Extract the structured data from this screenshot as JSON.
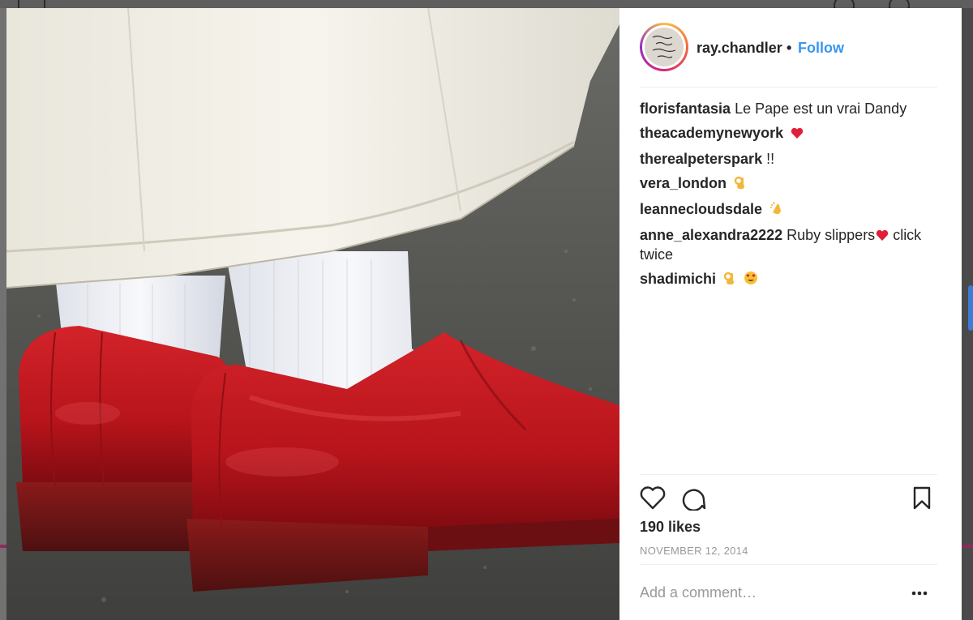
{
  "post": {
    "username": "ray.chandler",
    "separator": "•",
    "follow_label": "Follow",
    "avatar_icon": "handwritten-note-avatar",
    "likes": "190 likes",
    "date": "NOVEMBER 12, 2014",
    "comment_placeholder": "Add a comment…",
    "more_label": "•••"
  },
  "comments": [
    {
      "author": "florisfantasia",
      "text": "Le Pape est un vrai Dandy",
      "emojis": []
    },
    {
      "author": "theacademynewyork",
      "text": "",
      "emojis": [
        "heart"
      ]
    },
    {
      "author": "therealpeterspark",
      "text": "!!",
      "emojis": []
    },
    {
      "author": "vera_london",
      "text": "",
      "emojis": [
        "ok-hand"
      ]
    },
    {
      "author": "leannecloudsdale",
      "text": "",
      "emojis": [
        "clapping-hands"
      ]
    },
    {
      "author": "anne_alexandra2222",
      "text": "Ruby slippers",
      "emojis": [
        "heart"
      ],
      "text_after": " click twice"
    },
    {
      "author": "shadimichi",
      "text": "",
      "emojis": [
        "ok-hand",
        "heart-eyes"
      ]
    }
  ],
  "icons": {
    "like": "heart-outline-icon",
    "comment": "speech-bubble-icon",
    "save": "bookmark-icon",
    "more": "more-options-icon"
  },
  "colors": {
    "link": "#3897f0",
    "text": "#262626",
    "muted": "#999999",
    "shoe_red": "#c4161c"
  }
}
